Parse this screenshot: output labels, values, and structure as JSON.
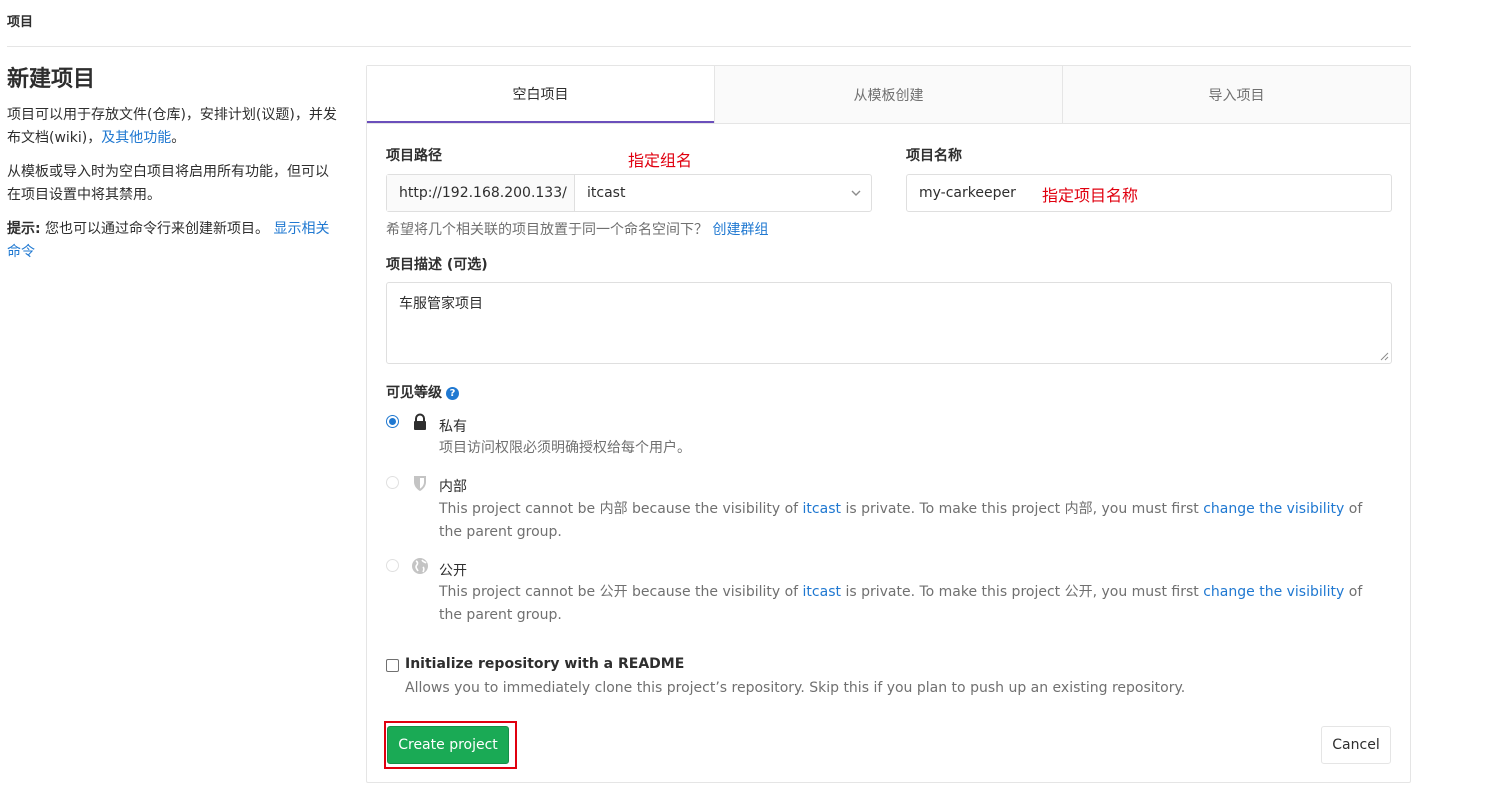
{
  "breadcrumb": "项目",
  "left": {
    "title": "新建项目",
    "para1_text": "项目可以用于存放文件(仓库)，安排计划(议题)，并发布文档(wiki)，",
    "para1_link": "及其他功能",
    "para1_end": "。",
    "para2": "从模板或导入时为空白项目将启用所有功能，但可以在项目设置中将其禁用。",
    "tip_label": "提示:",
    "tip_text": " 您也可以通过命令行来创建新项目。 ",
    "tip_link": "显示相关命令"
  },
  "tabs": [
    {
      "label": "空白项目",
      "active": true
    },
    {
      "label": "从模板创建",
      "active": false
    },
    {
      "label": "导入项目",
      "active": false
    }
  ],
  "form": {
    "path_label": "项目路径",
    "path_annotation": "指定组名",
    "path_prefix": "http://192.168.200.133/",
    "namespace_value": "itcast",
    "name_label": "项目名称",
    "name_value": "my-carkeeper",
    "name_annotation": "指定项目名称",
    "group_help": "希望将几个相关联的项目放置于同一个命名空间下？",
    "group_link": "创建群组",
    "desc_label": "项目描述 (可选)",
    "desc_value": "车服管家项目",
    "visibility_label": "可见等级",
    "help_icon_glyph": "?"
  },
  "visibility": {
    "private": {
      "title": "私有",
      "desc": "项目访问权限必须明确授权给每个用户。",
      "icon": "lock-icon",
      "checked": true
    },
    "internal": {
      "title": "内部",
      "desc_a": "This project cannot be 内部 because the visibility of ",
      "group_link": "itcast",
      "desc_b": " is private. To make this project 内部, you must first ",
      "change_link": "change the visibility",
      "desc_c": " of the parent group.",
      "icon": "shield-icon"
    },
    "public": {
      "title": "公开",
      "desc_a": "This project cannot be 公开 because the visibility of ",
      "group_link": "itcast",
      "desc_b": " is private. To make this project 公开, you must first ",
      "change_link": "change the visibility",
      "desc_c": " of the parent group.",
      "icon": "globe-icon"
    }
  },
  "readme": {
    "label": "Initialize repository with a README",
    "help": "Allows you to immediately clone this project’s repository. Skip this if you plan to push up an existing repository."
  },
  "buttons": {
    "create": "Create project",
    "cancel": "Cancel"
  },
  "colors": {
    "link": "#1f78d1",
    "create_button": "#1aaa55",
    "annotation": "#e0000f",
    "active_tab_indicator": "#6b4fbb"
  }
}
